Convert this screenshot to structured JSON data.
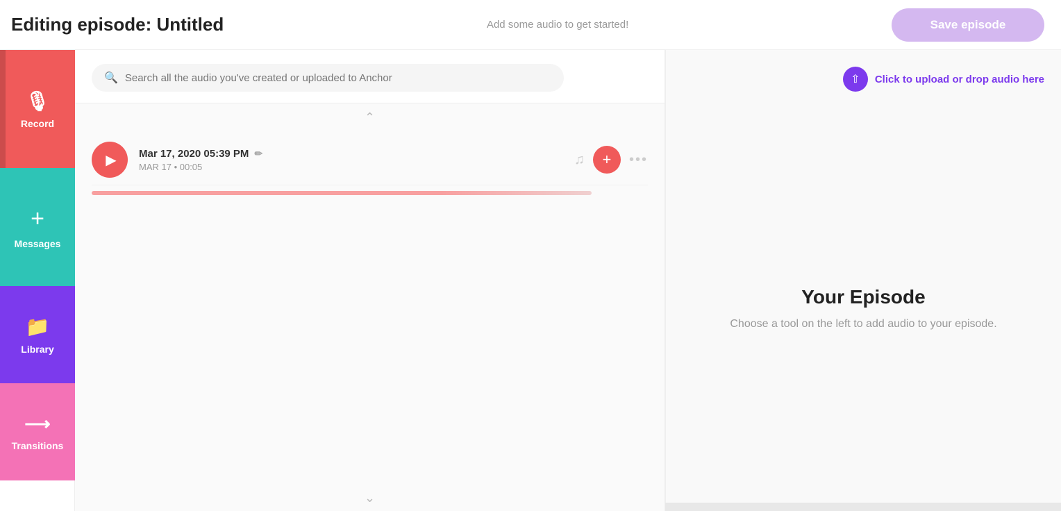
{
  "header": {
    "title": "Editing episode: Untitled",
    "hint": "Add some audio to get started!",
    "save_label": "Save episode"
  },
  "sidebar": {
    "items": [
      {
        "id": "record",
        "label": "Record",
        "icon": "🎙"
      },
      {
        "id": "messages",
        "label": "Messages",
        "icon": "+"
      },
      {
        "id": "library",
        "label": "Library",
        "icon": "📁"
      },
      {
        "id": "transitions",
        "label": "Transitions",
        "icon": "→"
      }
    ]
  },
  "search": {
    "placeholder": "Search all the audio you've created or uploaded to Anchor"
  },
  "audio_items": [
    {
      "title": "Mar 17, 2020 05:39 PM",
      "meta": "MAR 17 • 00:05"
    }
  ],
  "upload": {
    "label": "Click to upload or drop audio here"
  },
  "episode": {
    "empty_title": "Your Episode",
    "empty_subtitle": "Choose a tool on the left to add audio to your episode."
  }
}
